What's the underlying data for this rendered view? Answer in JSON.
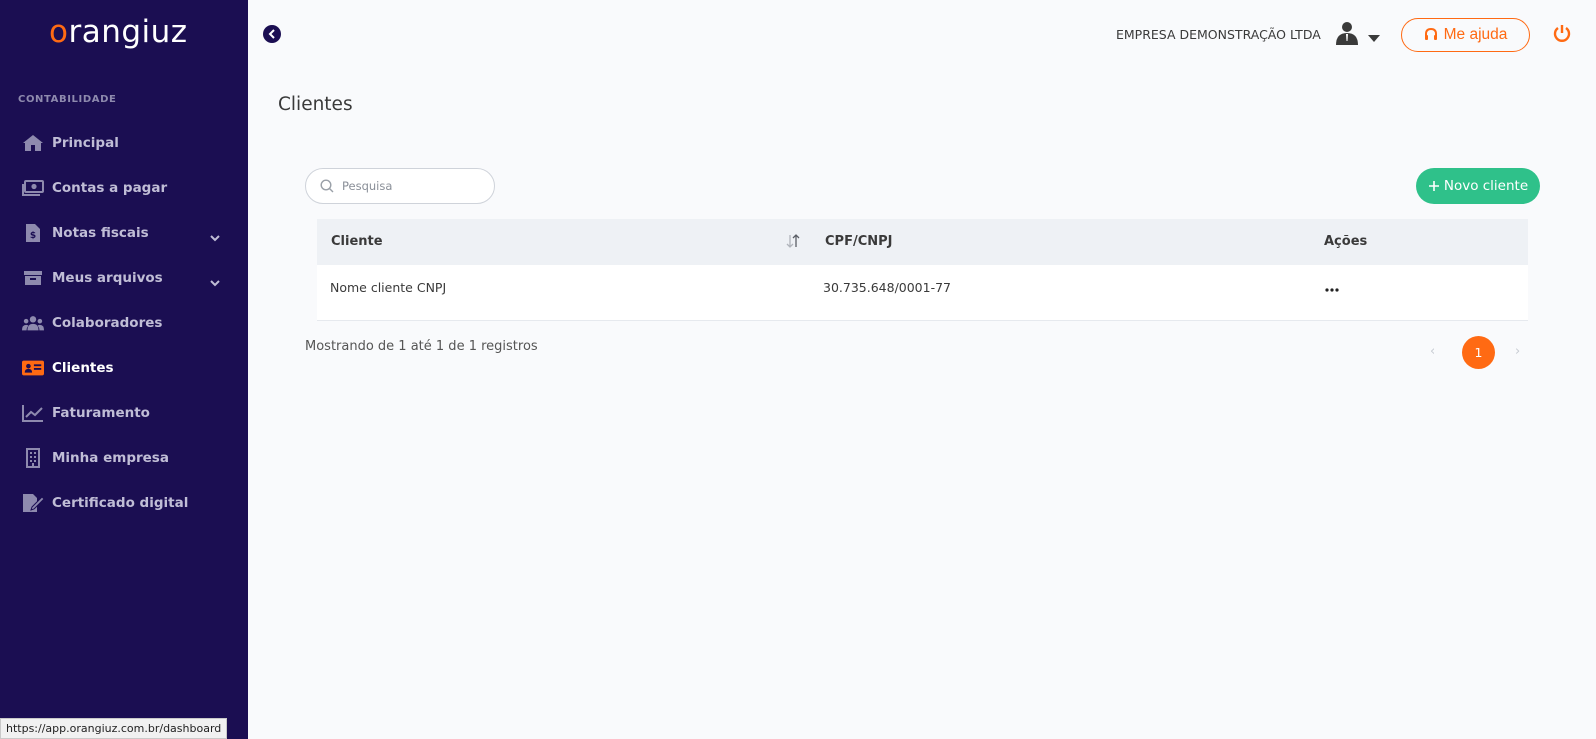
{
  "sidebar": {
    "logo": {
      "first": "o",
      "rest": "rangiuz"
    },
    "section_label": "CONTABILIDADE",
    "items": [
      {
        "label": "Principal"
      },
      {
        "label": "Contas a pagar"
      },
      {
        "label": "Notas fiscais"
      },
      {
        "label": "Meus arquivos"
      },
      {
        "label": "Colaboradores"
      },
      {
        "label": "Clientes"
      },
      {
        "label": "Faturamento"
      },
      {
        "label": "Minha empresa"
      },
      {
        "label": "Certificado digital"
      }
    ],
    "active_item": "Clientes"
  },
  "topbar": {
    "company": "EMPRESA DEMONSTRAÇÃO LTDA",
    "help_label": "Me ajuda"
  },
  "page": {
    "title": "Clientes",
    "search_placeholder": "Pesquisa",
    "new_button_label": "Novo cliente"
  },
  "table": {
    "columns": [
      "Cliente",
      "CPF/CNPJ",
      "Ações"
    ],
    "rows": [
      {
        "cliente": "Nome cliente CNPJ",
        "cpf_cnpj": "30.735.648/0001-77"
      }
    ]
  },
  "pagination": {
    "info": "Mostrando de 1 até 1 de 1 registros",
    "current_page": "1",
    "prev": "‹",
    "next": "›"
  },
  "status_bar": {
    "url": "https://app.orangiuz.com.br/dashboard"
  },
  "colors": {
    "sidebar_bg": "#1b0e52",
    "accent_orange": "#ff6a13",
    "success_green": "#2fc18a"
  }
}
